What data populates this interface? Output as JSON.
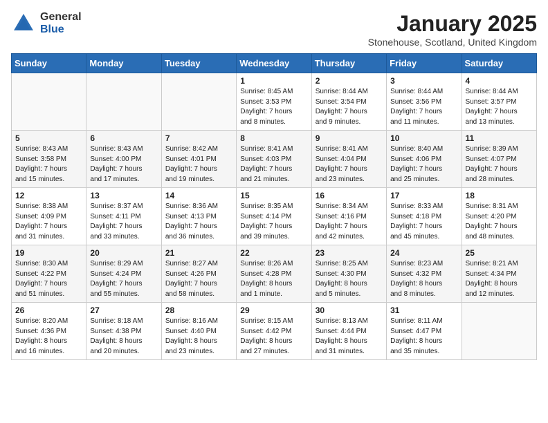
{
  "logo": {
    "general": "General",
    "blue": "Blue"
  },
  "title": "January 2025",
  "subtitle": "Stonehouse, Scotland, United Kingdom",
  "headers": [
    "Sunday",
    "Monday",
    "Tuesday",
    "Wednesday",
    "Thursday",
    "Friday",
    "Saturday"
  ],
  "weeks": [
    [
      {
        "day": "",
        "info": ""
      },
      {
        "day": "",
        "info": ""
      },
      {
        "day": "",
        "info": ""
      },
      {
        "day": "1",
        "info": "Sunrise: 8:45 AM\nSunset: 3:53 PM\nDaylight: 7 hours\nand 8 minutes."
      },
      {
        "day": "2",
        "info": "Sunrise: 8:44 AM\nSunset: 3:54 PM\nDaylight: 7 hours\nand 9 minutes."
      },
      {
        "day": "3",
        "info": "Sunrise: 8:44 AM\nSunset: 3:56 PM\nDaylight: 7 hours\nand 11 minutes."
      },
      {
        "day": "4",
        "info": "Sunrise: 8:44 AM\nSunset: 3:57 PM\nDaylight: 7 hours\nand 13 minutes."
      }
    ],
    [
      {
        "day": "5",
        "info": "Sunrise: 8:43 AM\nSunset: 3:58 PM\nDaylight: 7 hours\nand 15 minutes."
      },
      {
        "day": "6",
        "info": "Sunrise: 8:43 AM\nSunset: 4:00 PM\nDaylight: 7 hours\nand 17 minutes."
      },
      {
        "day": "7",
        "info": "Sunrise: 8:42 AM\nSunset: 4:01 PM\nDaylight: 7 hours\nand 19 minutes."
      },
      {
        "day": "8",
        "info": "Sunrise: 8:41 AM\nSunset: 4:03 PM\nDaylight: 7 hours\nand 21 minutes."
      },
      {
        "day": "9",
        "info": "Sunrise: 8:41 AM\nSunset: 4:04 PM\nDaylight: 7 hours\nand 23 minutes."
      },
      {
        "day": "10",
        "info": "Sunrise: 8:40 AM\nSunset: 4:06 PM\nDaylight: 7 hours\nand 25 minutes."
      },
      {
        "day": "11",
        "info": "Sunrise: 8:39 AM\nSunset: 4:07 PM\nDaylight: 7 hours\nand 28 minutes."
      }
    ],
    [
      {
        "day": "12",
        "info": "Sunrise: 8:38 AM\nSunset: 4:09 PM\nDaylight: 7 hours\nand 31 minutes."
      },
      {
        "day": "13",
        "info": "Sunrise: 8:37 AM\nSunset: 4:11 PM\nDaylight: 7 hours\nand 33 minutes."
      },
      {
        "day": "14",
        "info": "Sunrise: 8:36 AM\nSunset: 4:13 PM\nDaylight: 7 hours\nand 36 minutes."
      },
      {
        "day": "15",
        "info": "Sunrise: 8:35 AM\nSunset: 4:14 PM\nDaylight: 7 hours\nand 39 minutes."
      },
      {
        "day": "16",
        "info": "Sunrise: 8:34 AM\nSunset: 4:16 PM\nDaylight: 7 hours\nand 42 minutes."
      },
      {
        "day": "17",
        "info": "Sunrise: 8:33 AM\nSunset: 4:18 PM\nDaylight: 7 hours\nand 45 minutes."
      },
      {
        "day": "18",
        "info": "Sunrise: 8:31 AM\nSunset: 4:20 PM\nDaylight: 7 hours\nand 48 minutes."
      }
    ],
    [
      {
        "day": "19",
        "info": "Sunrise: 8:30 AM\nSunset: 4:22 PM\nDaylight: 7 hours\nand 51 minutes."
      },
      {
        "day": "20",
        "info": "Sunrise: 8:29 AM\nSunset: 4:24 PM\nDaylight: 7 hours\nand 55 minutes."
      },
      {
        "day": "21",
        "info": "Sunrise: 8:27 AM\nSunset: 4:26 PM\nDaylight: 7 hours\nand 58 minutes."
      },
      {
        "day": "22",
        "info": "Sunrise: 8:26 AM\nSunset: 4:28 PM\nDaylight: 8 hours\nand 1 minute."
      },
      {
        "day": "23",
        "info": "Sunrise: 8:25 AM\nSunset: 4:30 PM\nDaylight: 8 hours\nand 5 minutes."
      },
      {
        "day": "24",
        "info": "Sunrise: 8:23 AM\nSunset: 4:32 PM\nDaylight: 8 hours\nand 8 minutes."
      },
      {
        "day": "25",
        "info": "Sunrise: 8:21 AM\nSunset: 4:34 PM\nDaylight: 8 hours\nand 12 minutes."
      }
    ],
    [
      {
        "day": "26",
        "info": "Sunrise: 8:20 AM\nSunset: 4:36 PM\nDaylight: 8 hours\nand 16 minutes."
      },
      {
        "day": "27",
        "info": "Sunrise: 8:18 AM\nSunset: 4:38 PM\nDaylight: 8 hours\nand 20 minutes."
      },
      {
        "day": "28",
        "info": "Sunrise: 8:16 AM\nSunset: 4:40 PM\nDaylight: 8 hours\nand 23 minutes."
      },
      {
        "day": "29",
        "info": "Sunrise: 8:15 AM\nSunset: 4:42 PM\nDaylight: 8 hours\nand 27 minutes."
      },
      {
        "day": "30",
        "info": "Sunrise: 8:13 AM\nSunset: 4:44 PM\nDaylight: 8 hours\nand 31 minutes."
      },
      {
        "day": "31",
        "info": "Sunrise: 8:11 AM\nSunset: 4:47 PM\nDaylight: 8 hours\nand 35 minutes."
      },
      {
        "day": "",
        "info": ""
      }
    ]
  ]
}
